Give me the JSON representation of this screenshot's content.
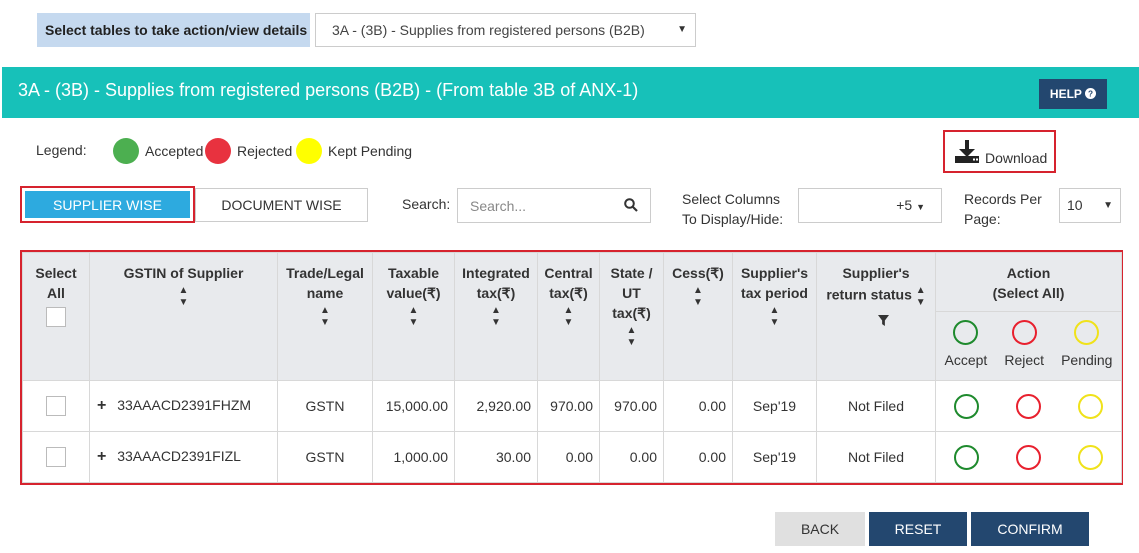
{
  "selector": {
    "label": "Select tables to take action/view details",
    "value": "3A - (3B) - Supplies from registered persons (B2B)"
  },
  "banner": {
    "title": "3A - (3B) - Supplies from registered persons (B2B) - (From table 3B of ANX-1)",
    "help_label": "HELP"
  },
  "legend": {
    "label": "Legend:",
    "items": [
      {
        "label": "Accepted",
        "color": "#4caf50"
      },
      {
        "label": "Rejected",
        "color": "#e8323f"
      },
      {
        "label": "Kept Pending",
        "color": "#ffff00"
      }
    ]
  },
  "download_label": "Download",
  "tabs": {
    "supplier": "SUPPLIER WISE",
    "document": "DOCUMENT WISE"
  },
  "search": {
    "label": "Search:",
    "placeholder": "Search..."
  },
  "columns": {
    "label_line1": "Select Columns",
    "label_line2": "To Display/Hide:",
    "value": "+5"
  },
  "records": {
    "label_line1": "Records Per",
    "label_line2": "Page:",
    "value": "10"
  },
  "table": {
    "headers": {
      "select_all": [
        "Select",
        "All"
      ],
      "gstin": "GSTIN of Supplier",
      "trade": [
        "Trade/Legal",
        "name"
      ],
      "taxable": [
        "Taxable",
        "value(₹)"
      ],
      "integrated": [
        "Integrated",
        "tax(₹)"
      ],
      "central": [
        "Central",
        "tax(₹)"
      ],
      "state": [
        "State /",
        "UT",
        "tax(₹)"
      ],
      "cess": "Cess(₹)",
      "period": [
        "Supplier's",
        "tax period"
      ],
      "status": [
        "Supplier's",
        "return status"
      ],
      "action": [
        "Action",
        "(Select All)"
      ],
      "accept": "Accept",
      "reject": "Reject",
      "pending": "Pending"
    },
    "rows": [
      {
        "gstin": "33AAACD2391FHZM",
        "trade": "GSTN",
        "taxable": "15,000.00",
        "integrated": "2,920.00",
        "central": "970.00",
        "state": "970.00",
        "cess": "0.00",
        "period": "Sep'19",
        "status": "Not Filed"
      },
      {
        "gstin": "33AAACD2391FIZL",
        "trade": "GSTN",
        "taxable": "1,000.00",
        "integrated": "30.00",
        "central": "0.00",
        "state": "0.00",
        "cess": "0.00",
        "period": "Sep'19",
        "status": "Not Filed"
      }
    ]
  },
  "buttons": {
    "back": "BACK",
    "reset": "RESET",
    "confirm": "CONFIRM"
  }
}
